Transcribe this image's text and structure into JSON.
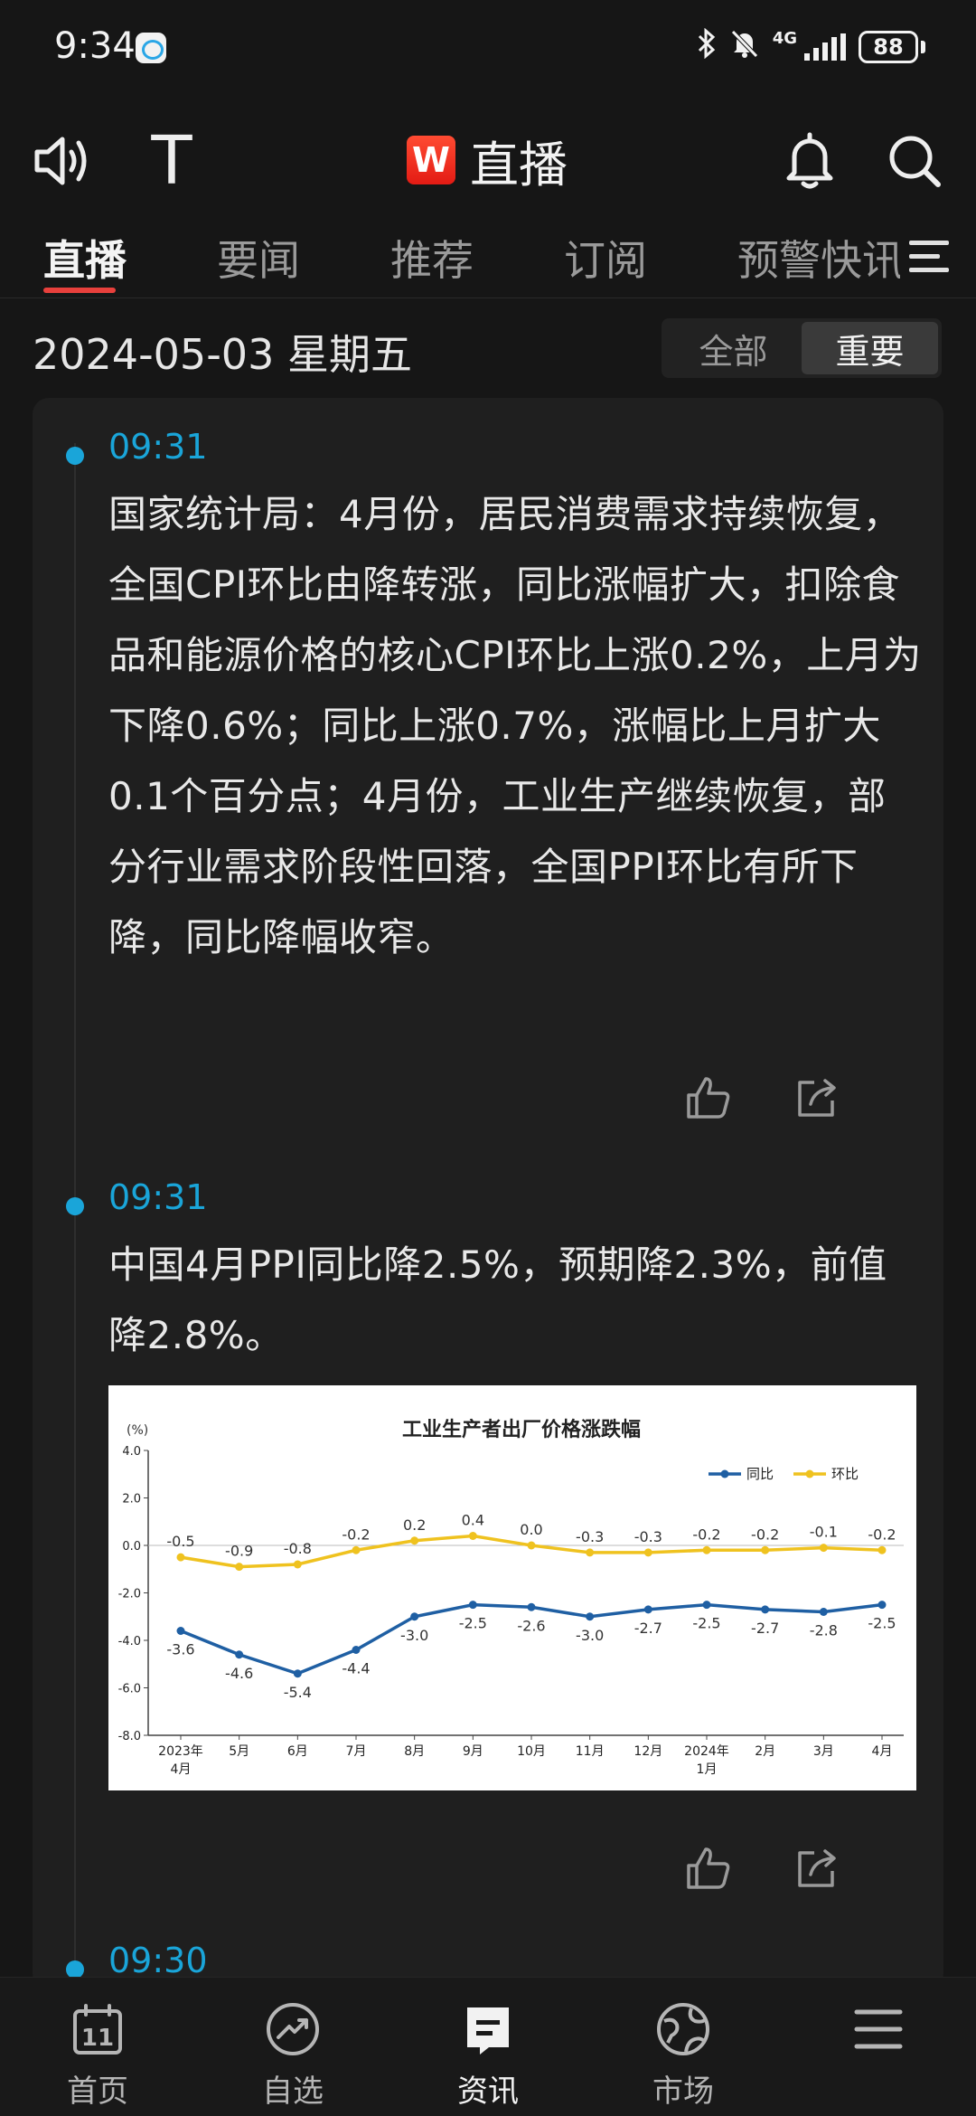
{
  "status_bar": {
    "time": "9:34",
    "network": "4G",
    "battery": "88"
  },
  "top_bar": {
    "text_size_glyph": "T",
    "brand_logo": "W",
    "title": "直播"
  },
  "tabs": [
    "直播",
    "要闻",
    "推荐",
    "订阅",
    "预警快讯"
  ],
  "date_row": {
    "date": "2024-05-03 星期五",
    "filters": [
      "全部",
      "重要"
    ]
  },
  "feed": [
    {
      "time": "09:31",
      "text": "国家统计局：4月份，居民消费需求持续恢复，全国CPI环比由降转涨，同比涨幅扩大，扣除食品和能源价格的核心CPI环比上涨0.2%，上月为下降0.6%；同比上涨0.7%，涨幅比上月扩大0.1个百分点；4月份，工业生产继续恢复，部分行业需求阶段性回落，全国PPI环比有所下降，同比降幅收窄。"
    },
    {
      "time": "09:31",
      "text": "中国4月PPI同比降2.5%，预期降2.3%，前值降2.8%。"
    },
    {
      "time": "09:30",
      "text": ""
    }
  ],
  "chart_data": {
    "type": "line",
    "title": "工业生产者出厂价格涨跌幅",
    "ylabel": "(%)",
    "ylim": [
      -8.0,
      4.0
    ],
    "yticks": [
      "4.0",
      "2.0",
      "0.0",
      "-2.0",
      "-4.0",
      "-6.0",
      "-8.0"
    ],
    "categories": [
      "2023年4月",
      "5月",
      "6月",
      "7月",
      "8月",
      "9月",
      "10月",
      "11月",
      "12月",
      "2024年1月",
      "2月",
      "3月",
      "4月"
    ],
    "x_labels": [
      [
        "2023年",
        "4月"
      ],
      [
        "5月"
      ],
      [
        "6月"
      ],
      [
        "7月"
      ],
      [
        "8月"
      ],
      [
        "9月"
      ],
      [
        "10月"
      ],
      [
        "11月"
      ],
      [
        "12月"
      ],
      [
        "2024年",
        "1月"
      ],
      [
        "2月"
      ],
      [
        "3月"
      ],
      [
        "4月"
      ]
    ],
    "series": [
      {
        "name": "同比",
        "color": "#1f5fa3",
        "values": [
          -3.6,
          -4.6,
          -5.4,
          -4.4,
          -3.0,
          -2.5,
          -2.6,
          -3.0,
          -2.7,
          -2.5,
          -2.7,
          -2.8,
          -2.5
        ],
        "labels": [
          "-3.6",
          "-4.6",
          "-5.4",
          "-4.4",
          "-3.0",
          "-2.5",
          "-2.6",
          "-3.0",
          "-2.7",
          "-2.5",
          "-2.7",
          "-2.8",
          "-2.5"
        ]
      },
      {
        "name": "环比",
        "color": "#efc21f",
        "values": [
          -0.5,
          -0.9,
          -0.8,
          -0.2,
          0.2,
          0.4,
          0.0,
          -0.3,
          -0.3,
          -0.2,
          -0.2,
          -0.1,
          -0.2
        ],
        "labels": [
          "-0.5",
          "-0.9",
          "-0.8",
          "-0.2",
          "0.2",
          "0.4",
          "0.0",
          "-0.3",
          "-0.3",
          "-0.2",
          "-0.2",
          "-0.1",
          "-0.2"
        ]
      }
    ],
    "legend": "top-right",
    "grid": false
  },
  "bottom_nav": [
    {
      "label": "首页",
      "icon": "calendar-icon",
      "badge": "11"
    },
    {
      "label": "自选",
      "icon": "trend-icon"
    },
    {
      "label": "资讯",
      "icon": "news-icon"
    },
    {
      "label": "市场",
      "icon": "globe-icon"
    },
    {
      "label": "",
      "icon": "menu-icon"
    }
  ],
  "colors": {
    "accent_blue": "#1aa5d9",
    "tab_underline": "#e8403c",
    "brand_red": "#e31b14",
    "background": "#161616"
  }
}
